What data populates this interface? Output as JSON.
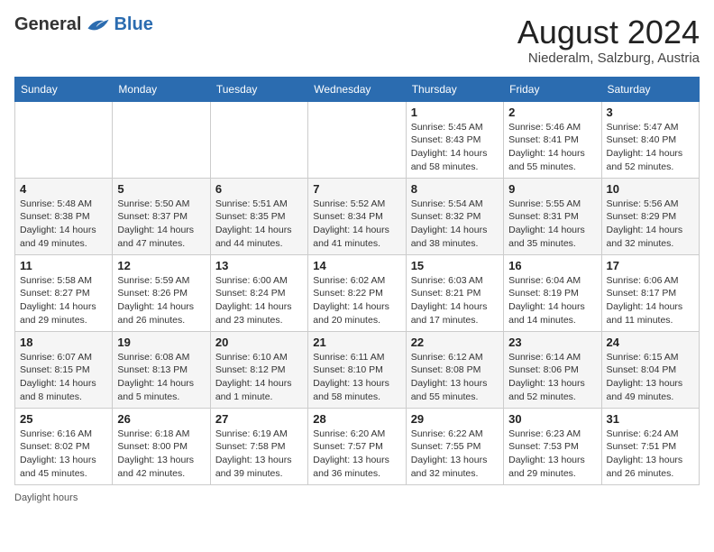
{
  "header": {
    "logo_general": "General",
    "logo_blue": "Blue",
    "month_year": "August 2024",
    "location": "Niederalm, Salzburg, Austria"
  },
  "days_of_week": [
    "Sunday",
    "Monday",
    "Tuesday",
    "Wednesday",
    "Thursday",
    "Friday",
    "Saturday"
  ],
  "footer": {
    "daylight_label": "Daylight hours"
  },
  "weeks": [
    [
      {
        "day": "",
        "info": ""
      },
      {
        "day": "",
        "info": ""
      },
      {
        "day": "",
        "info": ""
      },
      {
        "day": "",
        "info": ""
      },
      {
        "day": "1",
        "info": "Sunrise: 5:45 AM\nSunset: 8:43 PM\nDaylight: 14 hours and 58 minutes."
      },
      {
        "day": "2",
        "info": "Sunrise: 5:46 AM\nSunset: 8:41 PM\nDaylight: 14 hours and 55 minutes."
      },
      {
        "day": "3",
        "info": "Sunrise: 5:47 AM\nSunset: 8:40 PM\nDaylight: 14 hours and 52 minutes."
      }
    ],
    [
      {
        "day": "4",
        "info": "Sunrise: 5:48 AM\nSunset: 8:38 PM\nDaylight: 14 hours and 49 minutes."
      },
      {
        "day": "5",
        "info": "Sunrise: 5:50 AM\nSunset: 8:37 PM\nDaylight: 14 hours and 47 minutes."
      },
      {
        "day": "6",
        "info": "Sunrise: 5:51 AM\nSunset: 8:35 PM\nDaylight: 14 hours and 44 minutes."
      },
      {
        "day": "7",
        "info": "Sunrise: 5:52 AM\nSunset: 8:34 PM\nDaylight: 14 hours and 41 minutes."
      },
      {
        "day": "8",
        "info": "Sunrise: 5:54 AM\nSunset: 8:32 PM\nDaylight: 14 hours and 38 minutes."
      },
      {
        "day": "9",
        "info": "Sunrise: 5:55 AM\nSunset: 8:31 PM\nDaylight: 14 hours and 35 minutes."
      },
      {
        "day": "10",
        "info": "Sunrise: 5:56 AM\nSunset: 8:29 PM\nDaylight: 14 hours and 32 minutes."
      }
    ],
    [
      {
        "day": "11",
        "info": "Sunrise: 5:58 AM\nSunset: 8:27 PM\nDaylight: 14 hours and 29 minutes."
      },
      {
        "day": "12",
        "info": "Sunrise: 5:59 AM\nSunset: 8:26 PM\nDaylight: 14 hours and 26 minutes."
      },
      {
        "day": "13",
        "info": "Sunrise: 6:00 AM\nSunset: 8:24 PM\nDaylight: 14 hours and 23 minutes."
      },
      {
        "day": "14",
        "info": "Sunrise: 6:02 AM\nSunset: 8:22 PM\nDaylight: 14 hours and 20 minutes."
      },
      {
        "day": "15",
        "info": "Sunrise: 6:03 AM\nSunset: 8:21 PM\nDaylight: 14 hours and 17 minutes."
      },
      {
        "day": "16",
        "info": "Sunrise: 6:04 AM\nSunset: 8:19 PM\nDaylight: 14 hours and 14 minutes."
      },
      {
        "day": "17",
        "info": "Sunrise: 6:06 AM\nSunset: 8:17 PM\nDaylight: 14 hours and 11 minutes."
      }
    ],
    [
      {
        "day": "18",
        "info": "Sunrise: 6:07 AM\nSunset: 8:15 PM\nDaylight: 14 hours and 8 minutes."
      },
      {
        "day": "19",
        "info": "Sunrise: 6:08 AM\nSunset: 8:13 PM\nDaylight: 14 hours and 5 minutes."
      },
      {
        "day": "20",
        "info": "Sunrise: 6:10 AM\nSunset: 8:12 PM\nDaylight: 14 hours and 1 minute."
      },
      {
        "day": "21",
        "info": "Sunrise: 6:11 AM\nSunset: 8:10 PM\nDaylight: 13 hours and 58 minutes."
      },
      {
        "day": "22",
        "info": "Sunrise: 6:12 AM\nSunset: 8:08 PM\nDaylight: 13 hours and 55 minutes."
      },
      {
        "day": "23",
        "info": "Sunrise: 6:14 AM\nSunset: 8:06 PM\nDaylight: 13 hours and 52 minutes."
      },
      {
        "day": "24",
        "info": "Sunrise: 6:15 AM\nSunset: 8:04 PM\nDaylight: 13 hours and 49 minutes."
      }
    ],
    [
      {
        "day": "25",
        "info": "Sunrise: 6:16 AM\nSunset: 8:02 PM\nDaylight: 13 hours and 45 minutes."
      },
      {
        "day": "26",
        "info": "Sunrise: 6:18 AM\nSunset: 8:00 PM\nDaylight: 13 hours and 42 minutes."
      },
      {
        "day": "27",
        "info": "Sunrise: 6:19 AM\nSunset: 7:58 PM\nDaylight: 13 hours and 39 minutes."
      },
      {
        "day": "28",
        "info": "Sunrise: 6:20 AM\nSunset: 7:57 PM\nDaylight: 13 hours and 36 minutes."
      },
      {
        "day": "29",
        "info": "Sunrise: 6:22 AM\nSunset: 7:55 PM\nDaylight: 13 hours and 32 minutes."
      },
      {
        "day": "30",
        "info": "Sunrise: 6:23 AM\nSunset: 7:53 PM\nDaylight: 13 hours and 29 minutes."
      },
      {
        "day": "31",
        "info": "Sunrise: 6:24 AM\nSunset: 7:51 PM\nDaylight: 13 hours and 26 minutes."
      }
    ]
  ]
}
